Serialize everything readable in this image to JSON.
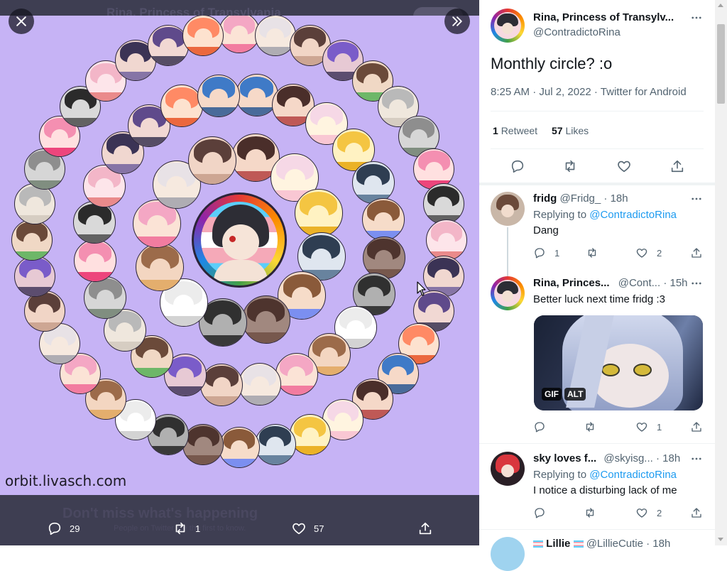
{
  "viewer": {
    "ghost_title": "Rina, Princess of Transylvania",
    "ghost_bottom": "Don't miss what's happening",
    "ghost_bottom2": "People on Twitter are the first to know.",
    "watermark": "orbit.livasch.com",
    "close_icon": "close-icon",
    "expand_icon": "double-chevron-right-icon",
    "reply_count": "29",
    "retweet_count": "1",
    "like_count": "57"
  },
  "tweet": {
    "author_name": "Rina, Princess of Transylv...",
    "author_handle": "@ContradictoRina",
    "text": "Monthly circle? :o",
    "meta": "8:25 AM · Jul 2, 2022 · Twitter for Android",
    "retweets_num": "1",
    "retweets_label": "Retweet",
    "likes_num": "57",
    "likes_label": "Likes"
  },
  "replies": [
    {
      "name": "fridg",
      "handle": "@Fridg_",
      "time": "· 18h",
      "replying_label": "Replying to",
      "replying_to": "@ContradictoRina",
      "text": "Dang",
      "reply_count": "1",
      "retweet_count": "",
      "like_count": "2"
    },
    {
      "name": "Rina, Princes...",
      "handle": "@Cont...",
      "time": "· 15h",
      "text": "Better luck next time fridg :3",
      "gif_badge": "GIF",
      "alt_badge": "ALT",
      "reply_count": "",
      "retweet_count": "",
      "like_count": "1"
    },
    {
      "name": "sky loves f...",
      "handle": "@skyisg...",
      "time": "· 18h",
      "replying_label": "Replying to",
      "replying_to": "@ContradictoRina",
      "text": "I notice a disturbing lack of me",
      "reply_count": "",
      "retweet_count": "",
      "like_count": "2"
    },
    {
      "name": "Lillie",
      "handle": "@LillieCutie",
      "time": "· 18h"
    }
  ],
  "colors": {
    "accent": "#1d9bf0",
    "image_bg": "#c6b3f5",
    "viewer_bg": "#3e3e52"
  }
}
